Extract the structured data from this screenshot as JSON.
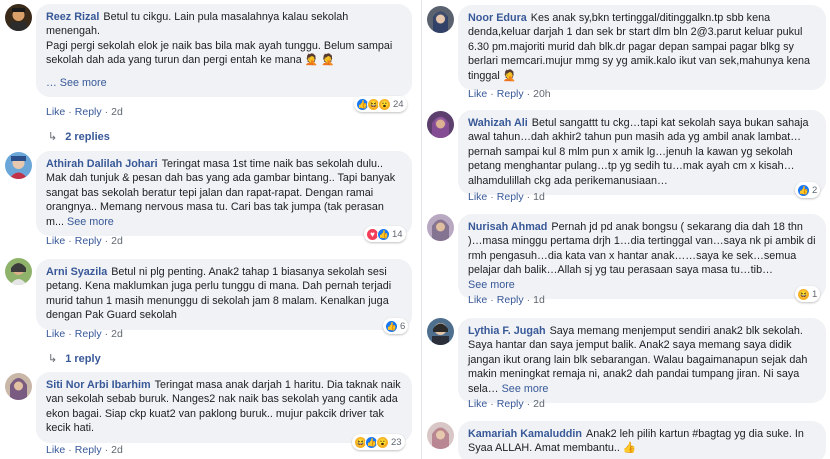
{
  "left_column": [
    {
      "author": "Reez Rizal",
      "paragraphs": [
        "Betul tu cikgu. Lain pula masalahnya kalau sekolah menengah.",
        "Pagi pergi sekolah elok je naik bas bila mak ayah tunggu. Belum sampai sekolah dah ada yang turun dan pergi entah ke mana 🤦 🤦"
      ],
      "see_more": "… See more",
      "like": "Like",
      "reply": "Reply",
      "time": "2d",
      "reaction_icons": [
        "like-icon",
        "haha-icon",
        "wow-icon"
      ],
      "reaction_count": "24",
      "replies": "2 replies"
    },
    {
      "author": "Athirah Dalilah Johari",
      "paragraphs": [
        "Teringat masa 1st time naik bas sekolah dulu.. Mak dah tunjuk & pesan dah bas yang ada gambar bintang.. Tapi banyak sangat bas sekolah beratur tepi jalan dan rapat-rapat. Dengan ramai orangnya.. Memang nervous masa tu. Cari bas tak jumpa (tak perasan m..."
      ],
      "see_more": "See more",
      "like": "Like",
      "reply": "Reply",
      "time": "2d",
      "reaction_icons": [
        "love-icon",
        "like-icon"
      ],
      "reaction_count": "14"
    },
    {
      "author": "Arni Syazila",
      "paragraphs": [
        "Betul ni plg penting. Anak2 tahap 1 biasanya sekolah sesi petang. Kena maklumkan juga perlu tunggu di mana. Dah pernah terjadi murid tahun 1 masih menunggu di sekolah jam 8 malam. Kenalkan juga dengan Pak Guard sekolah"
      ],
      "like": "Like",
      "reply": "Reply",
      "time": "2d",
      "reaction_icons": [
        "like-icon"
      ],
      "reaction_count": "6",
      "replies": "1 reply"
    },
    {
      "author": "Siti Nor Arbi Ibarhim",
      "paragraphs": [
        "Teringat masa anak darjah 1 haritu. Dia taknak naik van sekolah sebab buruk. Nanges2 nak naik bas sekolah yang cantik ada ekon bagai. Siap ckp kuat2 van paklong buruk.. mujur pakcik driver tak kecik hati."
      ],
      "like": "Like",
      "reply": "Reply",
      "time": "2d",
      "reaction_icons": [
        "haha-icon",
        "like-icon",
        "wow-icon"
      ],
      "reaction_count": "23"
    }
  ],
  "right_column": [
    {
      "author": "Noor Edura",
      "paragraphs": [
        "Kes anak sy,bkn tertinggal/ditinggalkn.tp sbb kena denda,keluar darjah 1 dan sek br start dlm bln 2@3.parut keluar pukul 6.30 pm.majoriti murid dah blk.dr pagar depan sampai pagar blkg sy berlari memcari.mujur mmg sy yg amik.kalo ikut van sek,mahunya kena tinggal 🤦"
      ],
      "like": "Like",
      "reply": "Reply",
      "time": "20h"
    },
    {
      "author": "Wahizah Ali",
      "paragraphs": [
        "Betul sangattt tu ckg…tapi kat sekolah saya bukan sahaja awal tahun…dah akhir2 tahun pun masih ada yg ambil anak lambat…pernah sampai kul 8 mlm pun x amik lg…jenuh la kawan yg sekolah petang menghantar pulang…tp yg sedih tu…mak ayah cm x kisah… alhamdulillah ckg ada perikemanusiaan…"
      ],
      "like": "Like",
      "reply": "Reply",
      "time": "1d",
      "reaction_icons": [
        "like-icon"
      ],
      "reaction_count": "2"
    },
    {
      "author": "Nurisah Ahmad",
      "paragraphs": [
        "Pernah jd pd anak bongsu ( sekarang dia dah 18 thn )…masa minggu pertama drjh 1…dia tertinggal van…saya nk pi ambik di rmh pengasuh…dia kata van x hantar anak……saya ke sek…semua pelajar dah balik…Allah sj yg tau perasaan saya masa tu…tib…"
      ],
      "see_more": "See more",
      "like": "Like",
      "reply": "Reply",
      "time": "1d",
      "reaction_icons": [
        "haha-icon"
      ],
      "reaction_count": "1"
    },
    {
      "author": "Lythia F. Jugah",
      "paragraphs": [
        "Saya memang menjemput sendiri anak2 blk sekolah. Saya hantar dan saya jemput balik. Anak2 saya memang saya didik jangan ikut orang lain blk sebarangan. Walau bagaimanapun sejak dah makin meningkat remaja ni, anak2 dah pandai tumpang jiran. Ni saya sela…"
      ],
      "see_more": "See more",
      "like": "Like",
      "reply": "Reply",
      "time": "2d"
    },
    {
      "author": "Kamariah Kamaluddin",
      "paragraphs": [
        "Anak2 leh pilih kartun #bagtag yg dia suke. In Syaa ALLAH. Amat membantu.. 👍"
      ]
    }
  ],
  "colors": {
    "author": "#385898",
    "bubble": "#f0f2f5",
    "meta": "#606770",
    "like": "#1877f2",
    "love": "#f33e58",
    "haha": "#f7b125"
  }
}
